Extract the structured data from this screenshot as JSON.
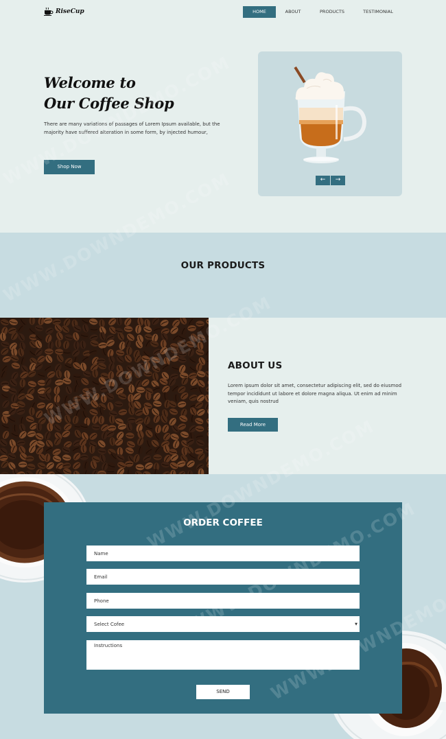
{
  "header": {
    "logo_text": "RiseCup",
    "nav": [
      {
        "label": "HOME",
        "active": true
      },
      {
        "label": "ABOUT",
        "active": false
      },
      {
        "label": "PRODUCTS",
        "active": false
      },
      {
        "label": "TESTIMONIAL",
        "active": false
      }
    ]
  },
  "hero": {
    "title_line1": "Welcome to",
    "title_line2": "Our Coffee Shop",
    "text": "There are many variations of passages of Lorem Ipsum available, but the majority have suffered alteration in some form, by injected humour,",
    "button_label": "Shop Now",
    "prev_arrow": "←",
    "next_arrow": "→"
  },
  "products": {
    "title": "OUR PRODUCTS"
  },
  "about": {
    "title": "ABOUT US",
    "text": "Lorem ipsum dolor sit amet, consectetur adipiscing elit, sed do eiusmod tempor incididunt ut labore et dolore magna aliqua. Ut enim ad minim veniam, quis nostrud",
    "button_label": "Read More"
  },
  "order": {
    "title": "ORDER COFFEE",
    "name_placeholder": "Name",
    "email_placeholder": "Email",
    "phone_placeholder": "Phone",
    "select_value": "Select Cofee",
    "instructions_placeholder": "Instructions",
    "send_label": "SEND"
  },
  "watermark": "WWW.DOWNDEMO.COM",
  "colors": {
    "accent": "#336e80",
    "page_bg": "#e6efed",
    "section_bg": "#c7dce1"
  }
}
